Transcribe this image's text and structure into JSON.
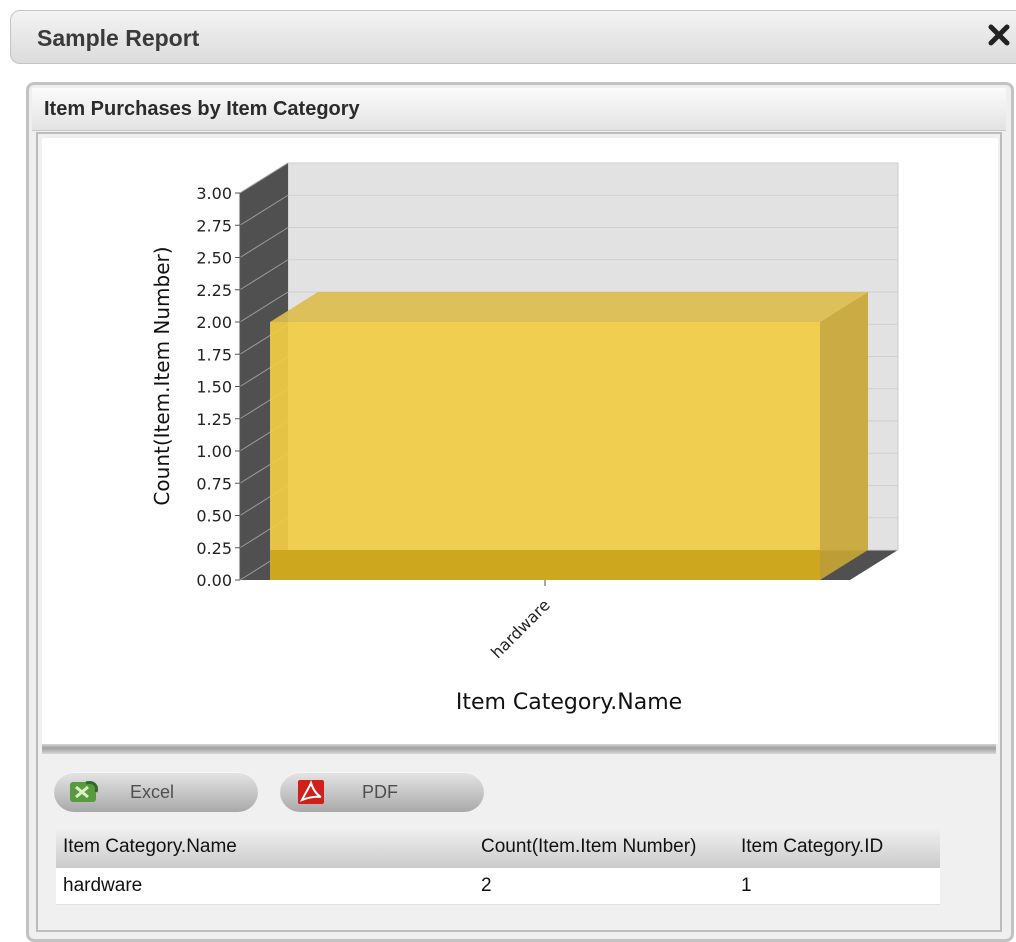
{
  "window": {
    "title": "Sample Report",
    "close_icon": "close-icon"
  },
  "panel": {
    "title": "Item Purchases by Item Category"
  },
  "chart_data": {
    "type": "bar",
    "categories": [
      "hardware"
    ],
    "values": [
      2
    ],
    "xlabel": "Item Category.Name",
    "ylabel": "Count(Item.Item Number)",
    "ylim": [
      0,
      3
    ],
    "yticks": [
      "0.00",
      "0.25",
      "0.50",
      "0.75",
      "1.00",
      "1.25",
      "1.50",
      "1.75",
      "2.00",
      "2.25",
      "2.50",
      "2.75",
      "3.00"
    ],
    "grid": true,
    "legend": "none",
    "style": "3d",
    "colors": {
      "bar": "#f0cc45",
      "wall": "#e2e2e2",
      "side": "#505050"
    }
  },
  "export": {
    "excel_label": "Excel",
    "excel_icon": "excel-icon",
    "pdf_label": "PDF",
    "pdf_icon": "pdf-icon"
  },
  "table": {
    "headers": [
      "Item Category.Name",
      "Count(Item.Item Number)",
      "Item Category.ID"
    ],
    "rows": [
      [
        "hardware",
        "2",
        "1"
      ]
    ]
  }
}
